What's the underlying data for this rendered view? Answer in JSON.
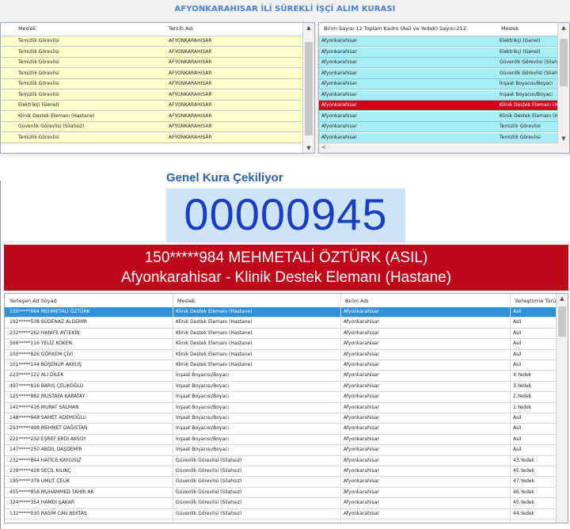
{
  "header": {
    "title": "AFYONKARAHISAR İLİ SÜREKLİ İŞÇİ ALIM KURASI"
  },
  "left_grid": {
    "columns": [
      "Meslek",
      "Tercih Adı"
    ],
    "rows": [
      [
        "Temizlik Görevlisi",
        "AFYONKARAHISAR"
      ],
      [
        "Temizlik Görevlisi",
        "AFYONKARAHISAR"
      ],
      [
        "Temizlik Görevlisi",
        "AFYONKARAHISAR"
      ],
      [
        "Temizlik Görevlisi",
        "AFYONKARAHISAR"
      ],
      [
        "Temizlik Görevlisi",
        "AFYONKARAHISAR"
      ],
      [
        "Temizlik Görevlisi",
        "AFYONKARAHISAR"
      ],
      [
        "Elektrikçi (Genel)",
        "AFYONKARAHISAR"
      ],
      [
        "Klinik Destek Elemanı (Hastane)",
        "AFYONKARAHISAR"
      ],
      [
        "Güvenlik Görevlisi (Silahsız)",
        "AFYONKARAHISAR"
      ],
      [
        "Temizlik Görevlisi",
        "AFYONKARAHISAR"
      ]
    ],
    "row_color": "#ffffcc"
  },
  "right_grid": {
    "columns": [
      "Birim Sayısı:12 Toplam Kadro (Asil ve Yedek) Sayısı:212",
      "Meslek"
    ],
    "rows": [
      [
        "Afyonkarahisar",
        "Elektrikçi (Genel)"
      ],
      [
        "Afyonkarahisar",
        "Elektrikçi (Genel)"
      ],
      [
        "Afyonkarahisar",
        "Güvenlik Görevlisi (Silahsız)"
      ],
      [
        "Afyonkarahisar",
        "Güvenlik Görevlisi (Silahsız)"
      ],
      [
        "Afyonkarahisar",
        "İnşaat Boyacısı/Boyacı"
      ],
      [
        "Afyonkarahisar",
        "İnşaat Boyacısı/Boyacı"
      ],
      [
        "Afyonkarahisar",
        "Klinik Destek Elemanı (Hastane)"
      ],
      [
        "Afyonkarahisar",
        "Klinik Destek Elemanı (Hastane)"
      ],
      [
        "Afyonkarahisar",
        "Temizlik Görevlisi"
      ],
      [
        "Afyonkarahisar",
        "Temizlik Görevlisi"
      ]
    ],
    "row_color": "#a8ecf4",
    "highlight_index": 6,
    "highlight_color": "#d4001a"
  },
  "draw": {
    "label": "Genel Kura Çekiliyor",
    "number": "00000945"
  },
  "banner": {
    "line1": "150*****984 MEHMETALİ ÖZTÜRK (ASIL)",
    "line2": "Afyonkarahisar - Klinik Destek Elemanı (Hastane)"
  },
  "results": {
    "columns": [
      "Yerleşen Ad Soyad",
      "Meslek",
      "Birim Adı",
      "Yerleştirme Türü"
    ],
    "selected_index": 0,
    "rows": [
      [
        "150*****984 MEHMETALİ ÖZTÜRK",
        "Klinik Destek Elemanı (Hastane)",
        "Afyonkarahisar",
        "Asil"
      ],
      [
        "192*****508 SÜDENAZ ALDEMİR",
        "Klinik Destek Elemanı (Hastane)",
        "Afyonkarahisar",
        "Asil"
      ],
      [
        "232*****262 HANİFE AYTEKİN",
        "Klinik Destek Elemanı (Hastane)",
        "Afyonkarahisar",
        "Asil"
      ],
      [
        "566*****116 YELİZ KÖKEN",
        "Klinik Destek Elemanı (Hastane)",
        "Afyonkarahisar",
        "Asil"
      ],
      [
        "100*****826 GÖRKEM ÇİVİ",
        "Klinik Destek Elemanı (Hastane)",
        "Afyonkarahisar",
        "Asil"
      ],
      [
        "101*****144 BÜŞENUR AKKUŞ",
        "Klinik Destek Elemanı (Hastane)",
        "Afyonkarahisar",
        "Asil"
      ],
      [
        "223*****122 ALİ DİLEK",
        "İnşaat Boyacısı/Boyacı",
        "Afyonkarahisar",
        "4.Yedek"
      ],
      [
        "497*****816 BARIŞ ÇELİKOĞLU",
        "İnşaat Boyacısı/Boyacı",
        "Afyonkarahisar",
        "3.Yedek"
      ],
      [
        "125*****882 MUSTAFA KARATAY",
        "İnşaat Boyacısı/Boyacı",
        "Afyonkarahisar",
        "2.Yedek"
      ],
      [
        "141*****416 MURAT SALMAN",
        "İnşaat Boyacısı/Boyacı",
        "Afyonkarahisar",
        "1.Yedek"
      ],
      [
        "148*****948 SAMET ADEMOĞLU",
        "İnşaat Boyacısı/Boyacı",
        "Afyonkarahisar",
        "Asil"
      ],
      [
        "253*****498 MEHMET DAĞISTAN",
        "İnşaat Boyacısı/Boyacı",
        "Afyonkarahisar",
        "Asil"
      ],
      [
        "221*****232 EŞREF ERDİ AKSOY",
        "İnşaat Boyacısı/Boyacı",
        "Afyonkarahisar",
        "Asil"
      ],
      [
        "147*****250 ABDİL DAŞDEMİR",
        "İnşaat Boyacısı/Boyacı",
        "Afyonkarahisar",
        "Asil"
      ],
      [
        "232*****844 HATİCE KAYGISIZ",
        "Güvenlik Görevlisi (Silahsız)",
        "Afyonkarahisar",
        "43.Yedek"
      ],
      [
        "239*****428 SEÇİL KILINÇ",
        "Güvenlik Görevlisi (Silahsız)",
        "Afyonkarahisar",
        "45.Yedek"
      ],
      [
        "195*****378 UMUT ÇELİK",
        "Güvenlik Görevlisi (Silahsız)",
        "Afyonkarahisar",
        "47.Yedek"
      ],
      [
        "455*****858 MUHAMMED TAHİR AK",
        "Güvenlik Görevlisi (Silahsız)",
        "Afyonkarahisar",
        "46.Yedek"
      ],
      [
        "324*****354 HAMDİ ŞAKAR",
        "Güvenlik Görevlisi (Silahsız)",
        "Afyonkarahisar",
        "45.Yedek"
      ],
      [
        "132*****030 RASİM CAN BEKTAŞ",
        "Güvenlik Görevlisi (Silahsız)",
        "Afyonkarahisar",
        "44.Yedek"
      ]
    ]
  },
  "icons": {
    "scroll_up": "▲",
    "scroll_down": "▼",
    "scroll_left": "<",
    "scroll_right": ">"
  }
}
